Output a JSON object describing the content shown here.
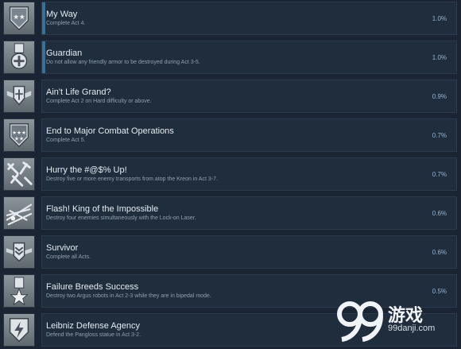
{
  "achievements": [
    {
      "title": "My Way",
      "description": "Complete Act 4.",
      "percent": "1.0%",
      "icon": "stars-chevron-shield-icon",
      "highlighted": true
    },
    {
      "title": "Guardian",
      "description": "Do not allow any friendly armor to be destroyed during Act 3-5.",
      "percent": "1.0%",
      "icon": "medal-cross-icon",
      "highlighted": true
    },
    {
      "title": "Ain't Life Grand?",
      "description": "Complete Act 2 on Hard difficulty or above.",
      "percent": "0.9%",
      "icon": "winged-shield-icon",
      "highlighted": false
    },
    {
      "title": "End to Major Combat Operations",
      "description": "Complete Act 5.",
      "percent": "0.7%",
      "icon": "five-stars-shield-icon",
      "highlighted": false
    },
    {
      "title": "Hurry the #@$% Up!",
      "description": "Destroy five or more enemy transports from atop the Kreon in Act 3-7.",
      "percent": "0.7%",
      "icon": "aircraft-formation-icon",
      "highlighted": false
    },
    {
      "title": "Flash! King of the Impossible",
      "description": "Destroy four enemies simultaneously with the Lock-on Laser.",
      "percent": "0.6%",
      "icon": "laser-beams-icon",
      "highlighted": false
    },
    {
      "title": "Survivor",
      "description": "Complete all Acts.",
      "percent": "0.6%",
      "icon": "winged-badge-icon",
      "highlighted": false
    },
    {
      "title": "Failure Breeds Success",
      "description": "Destroy two Argus robots in Act 2-3 while they are in bipedal mode.",
      "percent": "0.5%",
      "icon": "star-medal-icon",
      "highlighted": false
    },
    {
      "title": "Leibniz Defense Agency",
      "description": "Defend the Pangloss statue in Act 3-2.",
      "percent": "",
      "icon": "lightning-shield-icon",
      "highlighted": false
    }
  ],
  "watermark": {
    "text": "游戏",
    "sub": "99danji.com",
    "logo": "99-logo-icon"
  }
}
